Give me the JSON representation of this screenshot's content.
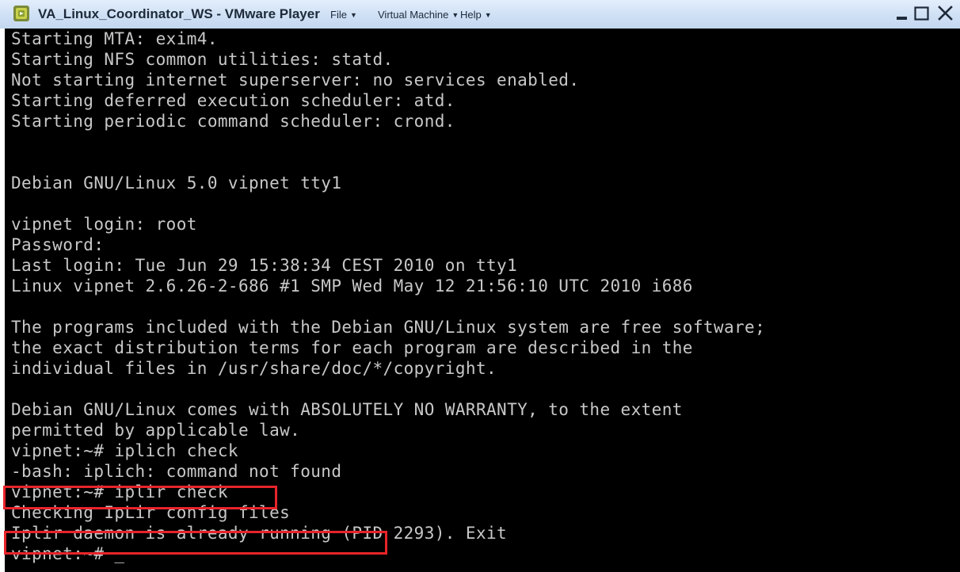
{
  "window": {
    "title": "VA_Linux_Coordinator_WS - VMware Player",
    "menu": [
      {
        "label": "File"
      },
      {
        "label": "Virtual Machine"
      },
      {
        "label": "Help"
      }
    ],
    "icons": {
      "app": "vmware-player-icon",
      "menu_arrow": "chevron-down-icon",
      "minimize": "minimize-icon",
      "maximize": "maximize-icon",
      "close": "close-icon"
    },
    "colors": {
      "terminal_bg": "#000000",
      "terminal_text": "#c8c8c8",
      "highlight": "#e8242a"
    }
  },
  "terminal": {
    "lines": [
      "Starting MTA: exim4.",
      "Starting NFS common utilities: statd.",
      "Not starting internet superserver: no services enabled.",
      "Starting deferred execution scheduler: atd.",
      "Starting periodic command scheduler: crond.",
      "",
      "Debian GNU/Linux 5.0 vipnet tty1",
      "",
      "vipnet login: root",
      "Password:",
      "Last login: Tue Jun 29 15:38:34 CEST 2010 on tty1",
      "Linux vipnet 2.6.26-2-686 #1 SMP Wed May 12 21:56:10 UTC 2010 i686",
      "",
      "The programs included with the Debian GNU/Linux system are free software;",
      "the exact distribution terms for each program are described in the",
      "individual files in /usr/share/doc/*/copyright.",
      "",
      "Debian GNU/Linux comes with ABSOLUTELY NO WARRANTY, to the extent",
      "permitted by applicable law.",
      "vipnet:~# iplich check",
      "-bash: iplich: command not found",
      "vipnet:~# iplir check",
      "Checking IpLir config files",
      "Iplir daemon is already running (PID 2293). Exit",
      "vipnet:~# _"
    ]
  }
}
